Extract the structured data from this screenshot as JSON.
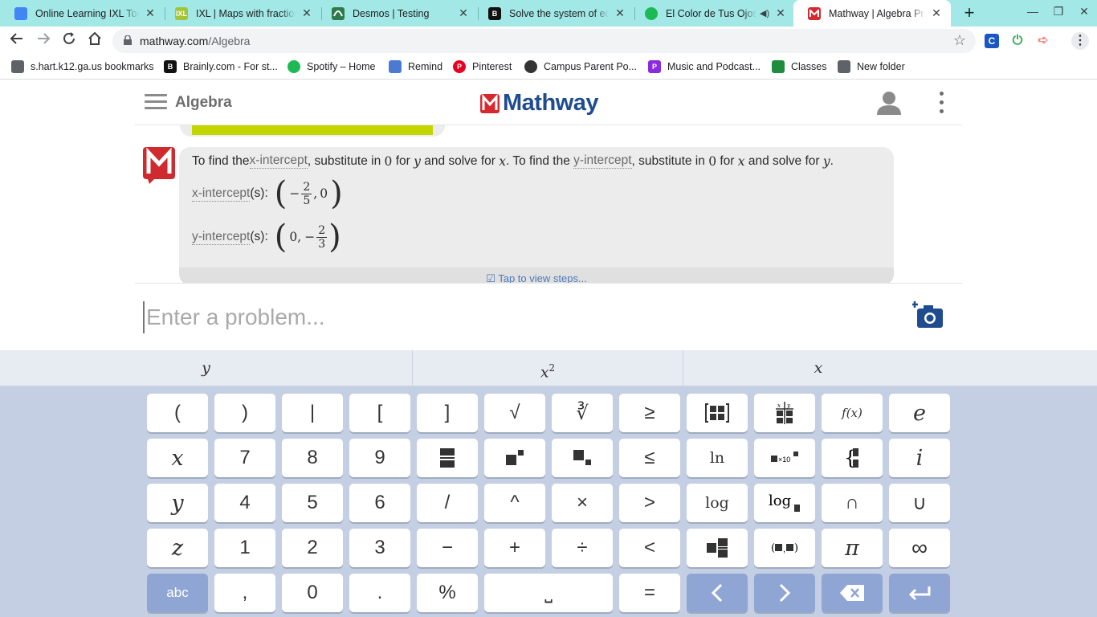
{
  "browser": {
    "tabs": [
      {
        "title": "Online Learning IXL Topi",
        "favicon_text": "",
        "favicon_color": "#4285f4"
      },
      {
        "title": "IXL | Maps with fractions",
        "favicon_text": "IXL",
        "favicon_color": "#a3c43a"
      },
      {
        "title": "Desmos | Testing",
        "favicon_text": "",
        "favicon_color": "#2f7a4a"
      },
      {
        "title": "Solve the system of equ",
        "favicon_text": "B",
        "favicon_color": "#111111"
      },
      {
        "title": "El Color de Tus Ojos",
        "favicon_text": "",
        "favicon_color": "#1db954"
      },
      {
        "title": "Mathway | Algebra Prob",
        "favicon_text": "",
        "favicon_color": "#d7282f"
      }
    ],
    "new_tab_label": "+",
    "url_host": "mathway.com",
    "url_path": "/Algebra",
    "bookmarks": [
      {
        "label": "s.hart.k12.ga.us bookmarks",
        "icon_color": "#5f6368",
        "icon_text": ""
      },
      {
        "label": "Brainly.com - For st...",
        "icon_color": "#111111",
        "icon_text": "B"
      },
      {
        "label": "Spotify – Home",
        "icon_color": "#1db954",
        "icon_text": ""
      },
      {
        "label": "Remind",
        "icon_color": "#4a7bd0",
        "icon_text": ""
      },
      {
        "label": "Pinterest",
        "icon_color": "#e60023",
        "icon_text": "P"
      },
      {
        "label": "Campus Parent Po...",
        "icon_color": "#333333",
        "icon_text": ""
      },
      {
        "label": "Music and Podcast...",
        "icon_color": "#8a2be2",
        "icon_text": "P"
      },
      {
        "label": "Classes",
        "icon_color": "#1e8e3e",
        "icon_text": ""
      },
      {
        "label": "New folder",
        "icon_color": "#5f6368",
        "icon_text": ""
      }
    ]
  },
  "app": {
    "section_title": "Algebra",
    "logo_text": "Mathway",
    "answer": {
      "intro": {
        "p1": "To find the ",
        "t1": "x-intercept",
        "p2": ", substitute in ",
        "n1": "0",
        "p3": " for ",
        "v1": "y",
        "p4": " and solve for ",
        "v2": "x",
        "p5": ". To find the ",
        "t2": "y-intercept",
        "p6": ", substitute in ",
        "n2": "0",
        "p7": " for ",
        "v3": "x",
        "p8": " and solve for ",
        "v4": "y",
        "p9": "."
      },
      "x_intercept": {
        "label": "x-intercept",
        "suffix": "(s):",
        "neg": "−",
        "num": "2",
        "den": "5",
        "other": "0"
      },
      "y_intercept": {
        "label": "y-intercept",
        "suffix": "(s):",
        "first": "0",
        "neg": "−",
        "num": "2",
        "den": "3"
      },
      "steps_link": "Tap to view steps..."
    },
    "input_placeholder": "Enter a problem..."
  },
  "suggestions": [
    "y",
    "x",
    "x"
  ],
  "suggestion_superscript": "2",
  "keyboard": {
    "rows": [
      [
        "(",
        ")",
        "|",
        "[",
        "]",
        "√",
        "∛",
        "≥",
        "[▪▪]",
        "⊞",
        "f(x)",
        "e"
      ],
      [
        "x",
        "7",
        "8",
        "9",
        "▬",
        "▪▪",
        "▪▫",
        "≤",
        "ln",
        "▪×10▪",
        "{▪",
        "i"
      ],
      [
        "y",
        "4",
        "5",
        "6",
        "/",
        "^",
        "×",
        ">",
        "log",
        "log▪",
        "∩",
        "∪"
      ],
      [
        "z",
        "1",
        "2",
        "3",
        "−",
        "+",
        "÷",
        "<",
        "▪▪",
        "(▪,▪)",
        "π",
        "∞"
      ]
    ],
    "bottom_row": [
      "abc",
      ",",
      "0",
      ".",
      "%",
      "⎵",
      "=",
      "‹",
      "›",
      "⌫",
      "↵"
    ]
  }
}
